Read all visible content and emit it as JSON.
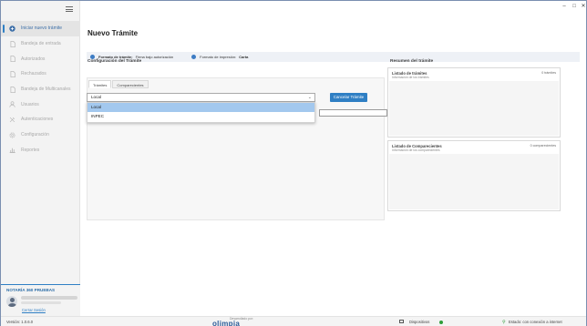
{
  "window": {
    "controls": {
      "minimize": "–",
      "maximize": "□",
      "close": "✕"
    }
  },
  "sidebar": {
    "items": [
      {
        "label": "Iniciar nuevo trámite",
        "icon": "plus-circle-icon",
        "active": true
      },
      {
        "label": "Bandeja de entrada",
        "icon": "document-icon",
        "active": false
      },
      {
        "label": "Autorizados",
        "icon": "document-icon",
        "active": false
      },
      {
        "label": "Rechazados",
        "icon": "document-icon",
        "active": false
      },
      {
        "label": "Bandeja de Multicanales",
        "icon": "document-icon",
        "active": false
      },
      {
        "label": "Usuarios",
        "icon": "user-icon",
        "active": false
      },
      {
        "label": "Autenticaciones",
        "icon": "tools-icon",
        "active": false
      },
      {
        "label": "Configuración",
        "icon": "gear-icon",
        "active": false
      },
      {
        "label": "Reportes",
        "icon": "bar-chart-icon",
        "active": false
      }
    ],
    "profile": {
      "organization": "NOTARÍA 360 PRUEBAS",
      "logout": "Cerrar Sesión"
    }
  },
  "main": {
    "title": "Nuevo Trámite",
    "infobar": {
      "format_label": "Formato de trámite:",
      "format_value": "Firma bajo autorización",
      "print_label": "Formato de impresión:",
      "print_value": "Carta"
    },
    "config": {
      "title": "Configuración del Trámite",
      "tabs": [
        "Trámites",
        "Comparecientes"
      ],
      "cancel_button": "Cancelar Trámite",
      "dropdown": {
        "value": "Local",
        "options": [
          "Local",
          "INPEC"
        ],
        "highlighted": "Local"
      }
    },
    "summary": {
      "title": "Resumen del trámite",
      "cards": [
        {
          "title": "Listado de trámites",
          "subtitle": "Información de los trámites",
          "count": "0 trámites"
        },
        {
          "title": "Listado de Comparecientes",
          "subtitle": "Información de los comparecientes",
          "count": "0 comparecientes"
        }
      ]
    }
  },
  "statusbar": {
    "version": "Versión: 1.0.6.0",
    "developed_by": "Desarrollado por:",
    "brand": "olimpia",
    "devices": "Dispositivos",
    "connection": "Estado: con conexión a internet"
  },
  "colors": {
    "accent": "#2f7fc4",
    "online": "#2e9e3a",
    "sidebar_bg": "#f3f3f3"
  }
}
